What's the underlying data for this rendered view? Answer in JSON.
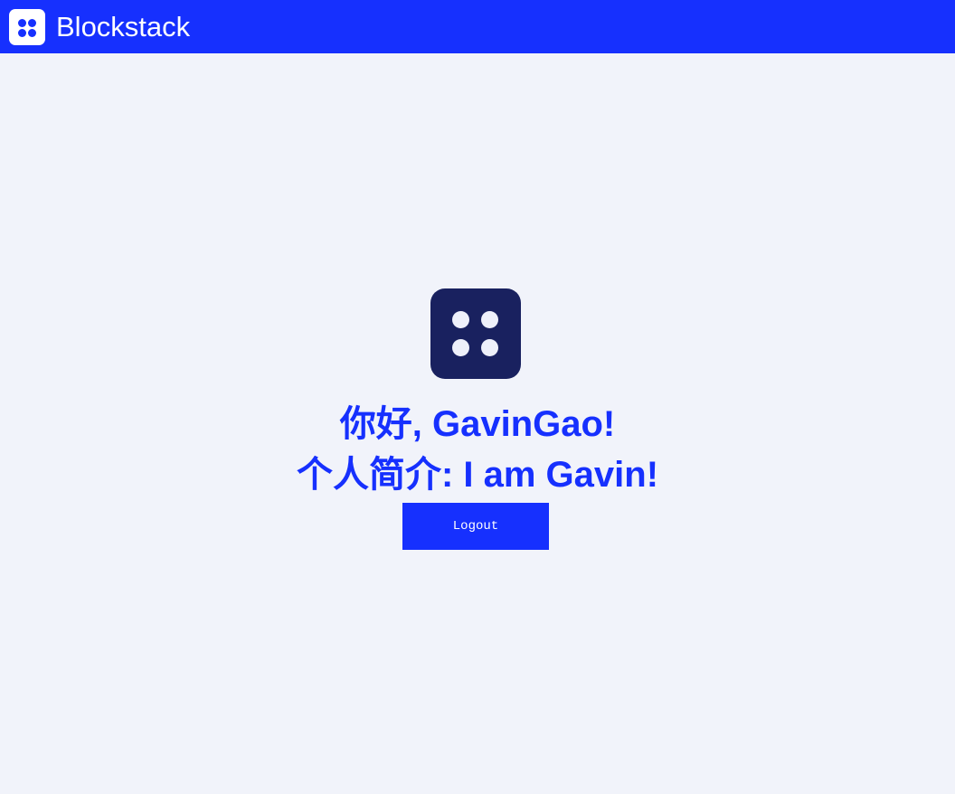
{
  "navbar": {
    "brand": "Blockstack",
    "logo_icon": "blockstack-logo-icon",
    "background": "#1630fe"
  },
  "main": {
    "avatar_icon": "blockstack-logo-icon",
    "greeting": "你好, GavinGao!",
    "bio": "个人简介: I am Gavin!",
    "logout_label": "Logout"
  },
  "colors": {
    "accent": "#1630fe",
    "page_background": "#f1f3fa",
    "logo_dark": "#19215f"
  }
}
